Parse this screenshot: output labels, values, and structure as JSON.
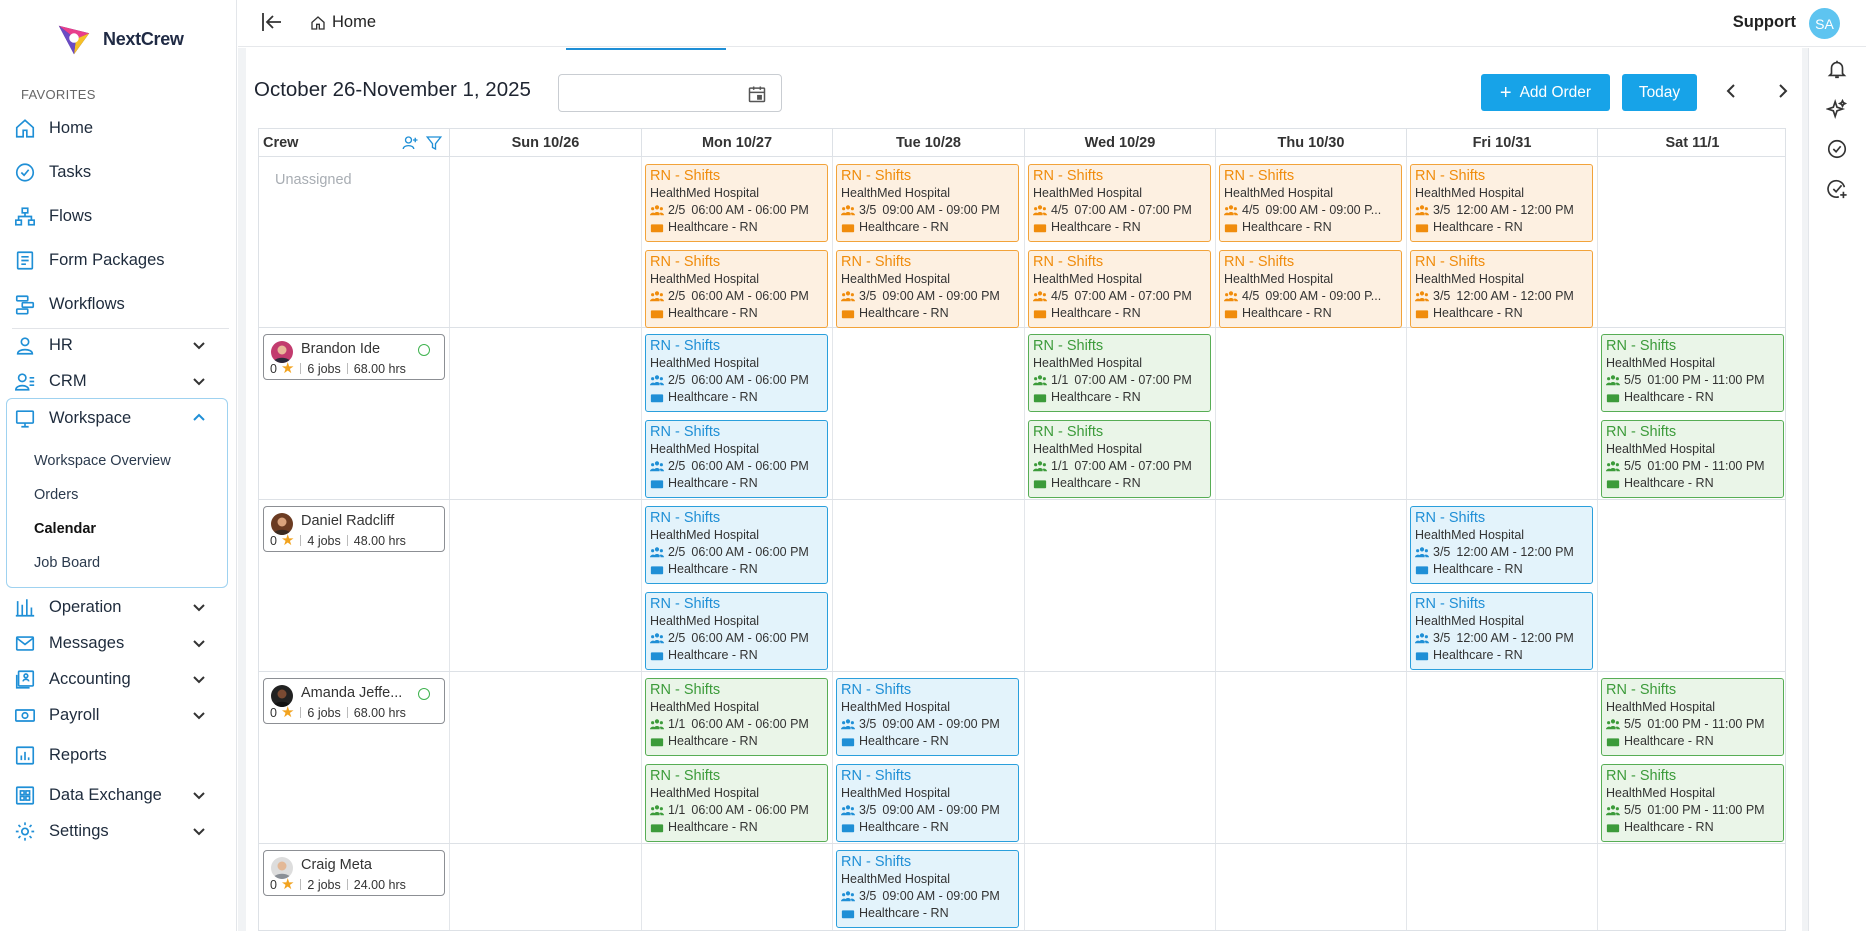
{
  "app": {
    "name": "NextCrew"
  },
  "sidebar": {
    "favorites_label": "FAVORITES",
    "items": [
      {
        "label": "Home",
        "icon": "home-icon"
      },
      {
        "label": "Tasks",
        "icon": "check-circle-icon"
      },
      {
        "label": "Flows",
        "icon": "flow-icon"
      },
      {
        "label": "Form Packages",
        "icon": "form-icon"
      },
      {
        "label": "Workflows",
        "icon": "workflow-icon"
      },
      {
        "label": "HR",
        "icon": "person-icon"
      },
      {
        "label": "CRM",
        "icon": "crm-icon"
      },
      {
        "label": "Workspace",
        "icon": "monitor-icon"
      },
      {
        "label": "Operation",
        "icon": "bar-chart-icon"
      },
      {
        "label": "Messages",
        "icon": "mail-icon"
      },
      {
        "label": "Accounting",
        "icon": "accounting-icon"
      },
      {
        "label": "Payroll",
        "icon": "payroll-icon"
      },
      {
        "label": "Reports",
        "icon": "report-icon"
      },
      {
        "label": "Data Exchange",
        "icon": "grid-icon"
      },
      {
        "label": "Settings",
        "icon": "gear-icon"
      }
    ],
    "workspace_sub": [
      "Workspace Overview",
      "Orders",
      "Calendar",
      "Job Board"
    ]
  },
  "topbar": {
    "breadcrumb": "Home",
    "support": "Support",
    "avatar": "SA"
  },
  "calendar": {
    "range": "October 26-November 1, 2025",
    "date_input": "",
    "add_order": "Add Order",
    "today": "Today",
    "crew_header": "Crew",
    "days": [
      "Sun 10/26",
      "Mon 10/27",
      "Tue 10/28",
      "Wed 10/29",
      "Thu 10/30",
      "Fri 10/31",
      "Sat 11/1"
    ],
    "unassigned": "Unassigned",
    "crew": [
      {
        "name": "Brandon Ide",
        "rating": "0",
        "jobs": "6 jobs",
        "hours": "68.00 hrs",
        "online": true
      },
      {
        "name": "Daniel Radcliff",
        "rating": "0",
        "jobs": "4 jobs",
        "hours": "48.00 hrs",
        "online": false
      },
      {
        "name": "Amanda Jeffe...",
        "rating": "0",
        "jobs": "6 jobs",
        "hours": "68.00 hrs",
        "online": true
      },
      {
        "name": "Craig Meta",
        "rating": "0",
        "jobs": "2 jobs",
        "hours": "24.00 hrs",
        "online": false
      }
    ],
    "shifts": [
      {
        "row": 0,
        "day": 1,
        "slot": 0,
        "color": "orange",
        "title": "RN - Shifts",
        "client": "HealthMed Hospital",
        "count": "2/5",
        "time": "06:00 AM - 06:00 PM",
        "role": "Healthcare - RN"
      },
      {
        "row": 0,
        "day": 1,
        "slot": 1,
        "color": "orange",
        "title": "RN - Shifts",
        "client": "HealthMed Hospital",
        "count": "2/5",
        "time": "06:00 AM - 06:00 PM",
        "role": "Healthcare - RN"
      },
      {
        "row": 0,
        "day": 2,
        "slot": 0,
        "color": "orange",
        "title": "RN - Shifts",
        "client": "HealthMed Hospital",
        "count": "3/5",
        "time": "09:00 AM - 09:00 PM",
        "role": "Healthcare - RN"
      },
      {
        "row": 0,
        "day": 2,
        "slot": 1,
        "color": "orange",
        "title": "RN - Shifts",
        "client": "HealthMed Hospital",
        "count": "3/5",
        "time": "09:00 AM - 09:00 PM",
        "role": "Healthcare - RN"
      },
      {
        "row": 0,
        "day": 3,
        "slot": 0,
        "color": "orange",
        "title": "RN - Shifts",
        "client": "HealthMed Hospital",
        "count": "4/5",
        "time": "07:00 AM - 07:00 PM",
        "role": "Healthcare - RN"
      },
      {
        "row": 0,
        "day": 3,
        "slot": 1,
        "color": "orange",
        "title": "RN - Shifts",
        "client": "HealthMed Hospital",
        "count": "4/5",
        "time": "07:00 AM - 07:00 PM",
        "role": "Healthcare - RN"
      },
      {
        "row": 0,
        "day": 4,
        "slot": 0,
        "color": "orange",
        "title": "RN - Shifts",
        "client": "HealthMed Hospital",
        "count": "4/5",
        "time": "09:00 AM - 09:00 P...",
        "role": "Healthcare - RN"
      },
      {
        "row": 0,
        "day": 4,
        "slot": 1,
        "color": "orange",
        "title": "RN - Shifts",
        "client": "HealthMed Hospital",
        "count": "4/5",
        "time": "09:00 AM - 09:00 P...",
        "role": "Healthcare - RN"
      },
      {
        "row": 0,
        "day": 5,
        "slot": 0,
        "color": "orange",
        "title": "RN - Shifts",
        "client": "HealthMed Hospital",
        "count": "3/5",
        "time": "12:00 AM - 12:00 PM",
        "role": "Healthcare - RN"
      },
      {
        "row": 0,
        "day": 5,
        "slot": 1,
        "color": "orange",
        "title": "RN - Shifts",
        "client": "HealthMed Hospital",
        "count": "3/5",
        "time": "12:00 AM - 12:00 PM",
        "role": "Healthcare - RN"
      },
      {
        "row": 1,
        "day": 1,
        "slot": 0,
        "color": "blue",
        "title": "RN - Shifts",
        "client": "HealthMed Hospital",
        "count": "2/5",
        "time": "06:00 AM - 06:00 PM",
        "role": "Healthcare - RN"
      },
      {
        "row": 1,
        "day": 1,
        "slot": 1,
        "color": "blue",
        "title": "RN - Shifts",
        "client": "HealthMed Hospital",
        "count": "2/5",
        "time": "06:00 AM - 06:00 PM",
        "role": "Healthcare - RN"
      },
      {
        "row": 1,
        "day": 3,
        "slot": 0,
        "color": "green",
        "title": "RN - Shifts",
        "client": "HealthMed Hospital",
        "count": "1/1",
        "time": "07:00 AM - 07:00 PM",
        "role": "Healthcare - RN"
      },
      {
        "row": 1,
        "day": 3,
        "slot": 1,
        "color": "green",
        "title": "RN - Shifts",
        "client": "HealthMed Hospital",
        "count": "1/1",
        "time": "07:00 AM - 07:00 PM",
        "role": "Healthcare - RN"
      },
      {
        "row": 1,
        "day": 6,
        "slot": 0,
        "color": "green",
        "title": "RN - Shifts",
        "client": "HealthMed Hospital",
        "count": "5/5",
        "time": "01:00 PM - 11:00 PM",
        "role": "Healthcare - RN"
      },
      {
        "row": 1,
        "day": 6,
        "slot": 1,
        "color": "green",
        "title": "RN - Shifts",
        "client": "HealthMed Hospital",
        "count": "5/5",
        "time": "01:00 PM - 11:00 PM",
        "role": "Healthcare - RN"
      },
      {
        "row": 2,
        "day": 1,
        "slot": 0,
        "color": "blue",
        "title": "RN - Shifts",
        "client": "HealthMed Hospital",
        "count": "2/5",
        "time": "06:00 AM - 06:00 PM",
        "role": "Healthcare - RN"
      },
      {
        "row": 2,
        "day": 1,
        "slot": 1,
        "color": "blue",
        "title": "RN - Shifts",
        "client": "HealthMed Hospital",
        "count": "2/5",
        "time": "06:00 AM - 06:00 PM",
        "role": "Healthcare - RN"
      },
      {
        "row": 2,
        "day": 5,
        "slot": 0,
        "color": "blue",
        "title": "RN - Shifts",
        "client": "HealthMed Hospital",
        "count": "3/5",
        "time": "12:00 AM - 12:00 PM",
        "role": "Healthcare - RN"
      },
      {
        "row": 2,
        "day": 5,
        "slot": 1,
        "color": "blue",
        "title": "RN - Shifts",
        "client": "HealthMed Hospital",
        "count": "3/5",
        "time": "12:00 AM - 12:00 PM",
        "role": "Healthcare - RN"
      },
      {
        "row": 3,
        "day": 1,
        "slot": 0,
        "color": "green",
        "title": "RN - Shifts",
        "client": "HealthMed Hospital",
        "count": "1/1",
        "time": "06:00 AM - 06:00 PM",
        "role": "Healthcare - RN"
      },
      {
        "row": 3,
        "day": 1,
        "slot": 1,
        "color": "green",
        "title": "RN - Shifts",
        "client": "HealthMed Hospital",
        "count": "1/1",
        "time": "06:00 AM - 06:00 PM",
        "role": "Healthcare - RN"
      },
      {
        "row": 3,
        "day": 2,
        "slot": 0,
        "color": "blue",
        "title": "RN - Shifts",
        "client": "HealthMed Hospital",
        "count": "3/5",
        "time": "09:00 AM - 09:00 PM",
        "role": "Healthcare - RN"
      },
      {
        "row": 3,
        "day": 2,
        "slot": 1,
        "color": "blue",
        "title": "RN - Shifts",
        "client": "HealthMed Hospital",
        "count": "3/5",
        "time": "09:00 AM - 09:00 PM",
        "role": "Healthcare - RN"
      },
      {
        "row": 3,
        "day": 6,
        "slot": 0,
        "color": "green",
        "title": "RN - Shifts",
        "client": "HealthMed Hospital",
        "count": "5/5",
        "time": "01:00 PM - 11:00 PM",
        "role": "Healthcare - RN"
      },
      {
        "row": 3,
        "day": 6,
        "slot": 1,
        "color": "green",
        "title": "RN - Shifts",
        "client": "HealthMed Hospital",
        "count": "5/5",
        "time": "01:00 PM - 11:00 PM",
        "role": "Healthcare - RN"
      },
      {
        "row": 4,
        "day": 2,
        "slot": 0,
        "color": "blue",
        "title": "RN - Shifts",
        "client": "HealthMed Hospital",
        "count": "3/5",
        "time": "09:00 AM - 09:00 PM",
        "role": "Healthcare - RN"
      }
    ]
  },
  "colors": {
    "accent": "#17a3e8",
    "orange": "#f08c0c",
    "blue": "#1f8fd6",
    "green": "#3c9b3a"
  }
}
